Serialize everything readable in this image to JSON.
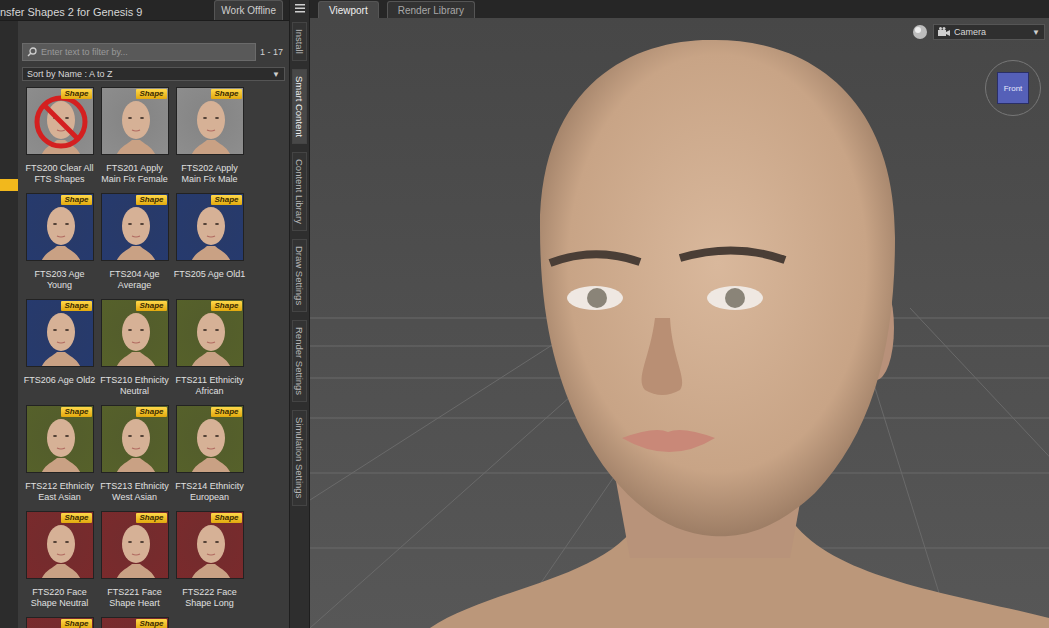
{
  "panel": {
    "title": "nsfer Shapes 2 for Genesis 9",
    "work_offline": "Work Offline",
    "search": {
      "placeholder": "Enter text to filter by...",
      "count": "1 - 17"
    },
    "sort": {
      "label": "Sort by Name : A to Z",
      "arrow": "▼"
    },
    "items": [
      {
        "label": "FTS200 Clear All FTS Shapes",
        "badge": "Shape",
        "color": "#8e8e8e",
        "kind": "clear"
      },
      {
        "label": "FTS201 Apply Main Fix Female",
        "badge": "Shape",
        "color": "#8e8e8e",
        "kind": "shape"
      },
      {
        "label": "FTS202 Apply Main Fix Male",
        "badge": "Shape",
        "color": "#8e8e8e",
        "kind": "shape"
      },
      {
        "label": "FTS203 Age Young",
        "badge": "Shape",
        "color": "#263a6e",
        "kind": "shape"
      },
      {
        "label": "FTS204 Age Average",
        "badge": "Shape",
        "color": "#263a6e",
        "kind": "shape"
      },
      {
        "label": "FTS205 Age Old1",
        "badge": "Shape",
        "color": "#263a6e",
        "kind": "shape"
      },
      {
        "label": "FTS206 Age Old2",
        "badge": "Shape",
        "color": "#263a6e",
        "kind": "shape"
      },
      {
        "label": "FTS210 Ethnicity Neutral",
        "badge": "Shape",
        "color": "#56612a",
        "kind": "shape"
      },
      {
        "label": "FTS211 Ethnicity African",
        "badge": "Shape",
        "color": "#56612a",
        "kind": "shape"
      },
      {
        "label": "FTS212 Ethnicity East Asian",
        "badge": "Shape",
        "color": "#56612a",
        "kind": "shape"
      },
      {
        "label": "FTS213 Ethnicity West Asian",
        "badge": "Shape",
        "color": "#56612a",
        "kind": "shape"
      },
      {
        "label": "FTS214 Ethnicity European",
        "badge": "Shape",
        "color": "#56612a",
        "kind": "shape"
      },
      {
        "label": "FTS220 Face Shape Neutral",
        "badge": "Shape",
        "color": "#7a2a2c",
        "kind": "shape"
      },
      {
        "label": "FTS221 Face Shape Heart",
        "badge": "Shape",
        "color": "#7a2a2c",
        "kind": "shape"
      },
      {
        "label": "FTS222 Face Shape Long",
        "badge": "Shape",
        "color": "#7a2a2c",
        "kind": "shape"
      },
      {
        "label": "",
        "badge": "Shape",
        "color": "#7a2a2c",
        "kind": "shape"
      },
      {
        "label": "",
        "badge": "Shape",
        "color": "#7a2a2c",
        "kind": "shape"
      }
    ]
  },
  "side_tabs": [
    {
      "label": "Install",
      "selected": false
    },
    {
      "label": "Smart Content",
      "selected": true
    },
    {
      "label": "Content Library",
      "selected": false
    },
    {
      "label": "Draw Settings",
      "selected": false
    },
    {
      "label": "Render Settings",
      "selected": false
    },
    {
      "label": "Simulation Settings",
      "selected": false
    }
  ],
  "view_tabs": [
    {
      "label": "Viewport",
      "selected": true
    },
    {
      "label": "Render Library",
      "selected": false
    }
  ],
  "viewport": {
    "camera": "Camera",
    "camera_arrow": "▼",
    "view_cube": "Front"
  }
}
